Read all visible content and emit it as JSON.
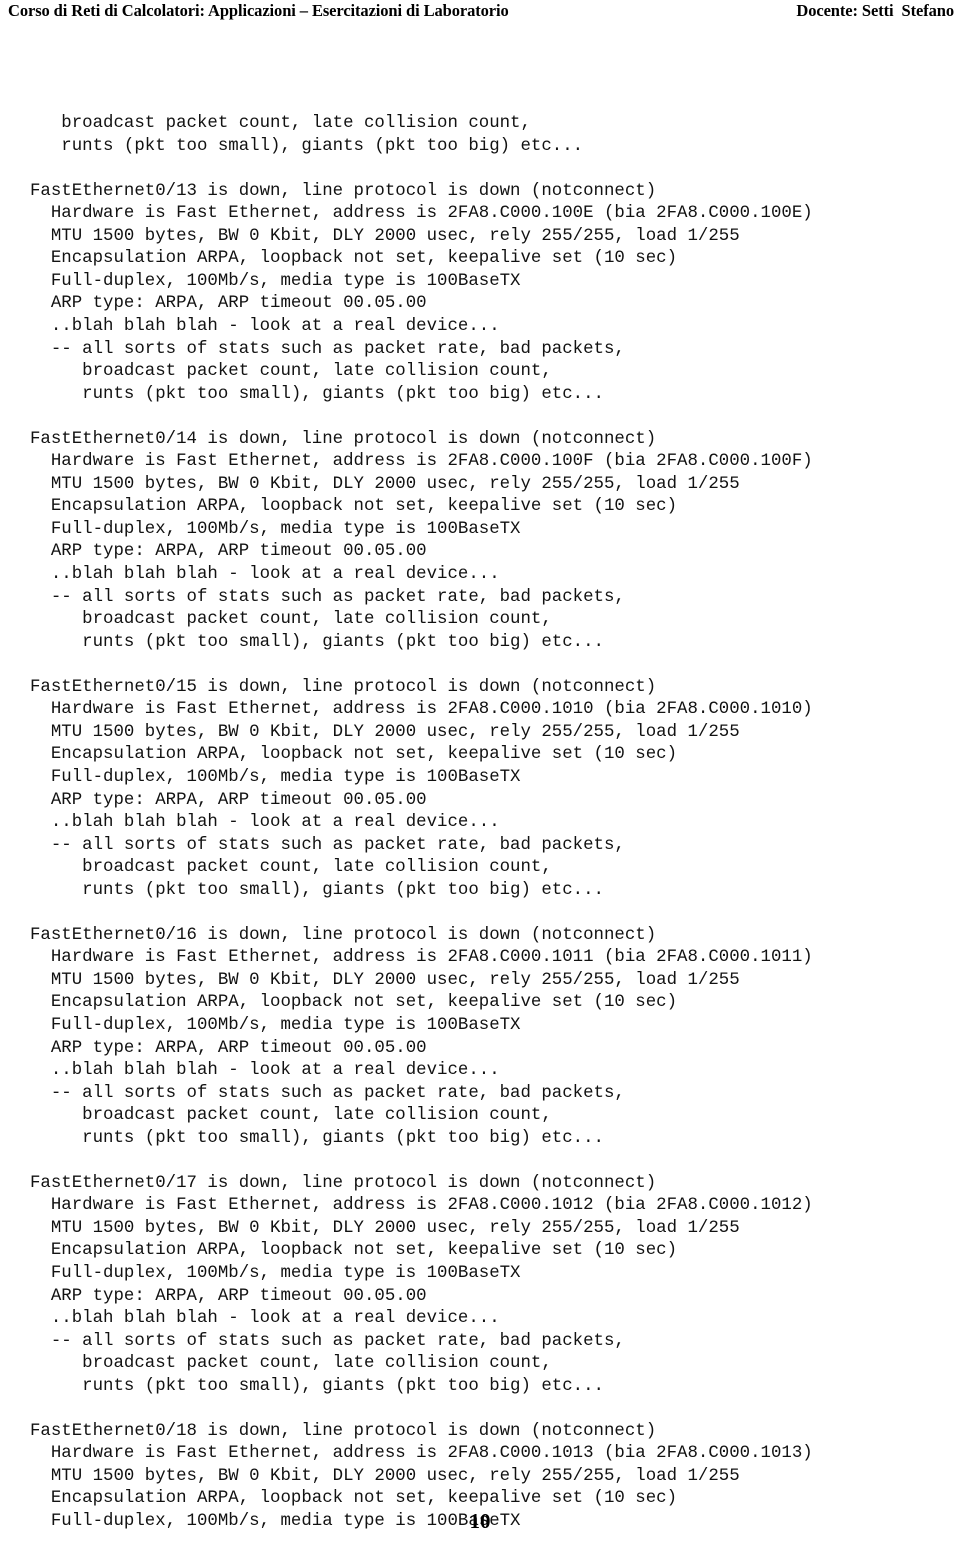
{
  "header": {
    "course_title": "Corso di Reti di Calcolatori: Applicazioni – Esercitazioni di Laboratorio",
    "instructor": "Docente: Setti  Stefano"
  },
  "footer": {
    "page_number": "10"
  },
  "console": {
    "continuation_lines": [
      "   broadcast packet count, late collision count,",
      "   runts (pkt too small), giants (pkt too big) etc..."
    ],
    "blocks": [
      {
        "id": "fa0-13",
        "lines": [
          "FastEthernet0/13 is down, line protocol is down (notconnect)",
          "  Hardware is Fast Ethernet, address is 2FA8.C000.100E (bia 2FA8.C000.100E)",
          "  MTU 1500 bytes, BW 0 Kbit, DLY 2000 usec, rely 255/255, load 1/255",
          "  Encapsulation ARPA, loopback not set, keepalive set (10 sec)",
          "  Full-duplex, 100Mb/s, media type is 100BaseTX",
          "  ARP type: ARPA, ARP timeout 00.05.00",
          "  ..blah blah blah - look at a real device...",
          "  -- all sorts of stats such as packet rate, bad packets,",
          "     broadcast packet count, late collision count,",
          "     runts (pkt too small), giants (pkt too big) etc..."
        ]
      },
      {
        "id": "fa0-14",
        "lines": [
          "FastEthernet0/14 is down, line protocol is down (notconnect)",
          "  Hardware is Fast Ethernet, address is 2FA8.C000.100F (bia 2FA8.C000.100F)",
          "  MTU 1500 bytes, BW 0 Kbit, DLY 2000 usec, rely 255/255, load 1/255",
          "  Encapsulation ARPA, loopback not set, keepalive set (10 sec)",
          "  Full-duplex, 100Mb/s, media type is 100BaseTX",
          "  ARP type: ARPA, ARP timeout 00.05.00",
          "  ..blah blah blah - look at a real device...",
          "  -- all sorts of stats such as packet rate, bad packets,",
          "     broadcast packet count, late collision count,",
          "     runts (pkt too small), giants (pkt too big) etc..."
        ]
      },
      {
        "id": "fa0-15",
        "lines": [
          "FastEthernet0/15 is down, line protocol is down (notconnect)",
          "  Hardware is Fast Ethernet, address is 2FA8.C000.1010 (bia 2FA8.C000.1010)",
          "  MTU 1500 bytes, BW 0 Kbit, DLY 2000 usec, rely 255/255, load 1/255",
          "  Encapsulation ARPA, loopback not set, keepalive set (10 sec)",
          "  Full-duplex, 100Mb/s, media type is 100BaseTX",
          "  ARP type: ARPA, ARP timeout 00.05.00",
          "  ..blah blah blah - look at a real device...",
          "  -- all sorts of stats such as packet rate, bad packets,",
          "     broadcast packet count, late collision count,",
          "     runts (pkt too small), giants (pkt too big) etc..."
        ]
      },
      {
        "id": "fa0-16",
        "lines": [
          "FastEthernet0/16 is down, line protocol is down (notconnect)",
          "  Hardware is Fast Ethernet, address is 2FA8.C000.1011 (bia 2FA8.C000.1011)",
          "  MTU 1500 bytes, BW 0 Kbit, DLY 2000 usec, rely 255/255, load 1/255",
          "  Encapsulation ARPA, loopback not set, keepalive set (10 sec)",
          "  Full-duplex, 100Mb/s, media type is 100BaseTX",
          "  ARP type: ARPA, ARP timeout 00.05.00",
          "  ..blah blah blah - look at a real device...",
          "  -- all sorts of stats such as packet rate, bad packets,",
          "     broadcast packet count, late collision count,",
          "     runts (pkt too small), giants (pkt too big) etc..."
        ]
      },
      {
        "id": "fa0-17",
        "lines": [
          "FastEthernet0/17 is down, line protocol is down (notconnect)",
          "  Hardware is Fast Ethernet, address is 2FA8.C000.1012 (bia 2FA8.C000.1012)",
          "  MTU 1500 bytes, BW 0 Kbit, DLY 2000 usec, rely 255/255, load 1/255",
          "  Encapsulation ARPA, loopback not set, keepalive set (10 sec)",
          "  Full-duplex, 100Mb/s, media type is 100BaseTX",
          "  ARP type: ARPA, ARP timeout 00.05.00",
          "  ..blah blah blah - look at a real device...",
          "  -- all sorts of stats such as packet rate, bad packets,",
          "     broadcast packet count, late collision count,",
          "     runts (pkt too small), giants (pkt too big) etc..."
        ]
      },
      {
        "id": "fa0-18",
        "lines": [
          "FastEthernet0/18 is down, line protocol is down (notconnect)",
          "  Hardware is Fast Ethernet, address is 2FA8.C000.1013 (bia 2FA8.C000.1013)",
          "  MTU 1500 bytes, BW 0 Kbit, DLY 2000 usec, rely 255/255, load 1/255",
          "  Encapsulation ARPA, loopback not set, keepalive set (10 sec)",
          "  Full-duplex, 100Mb/s, media type is 100BaseTX"
        ]
      }
    ]
  }
}
